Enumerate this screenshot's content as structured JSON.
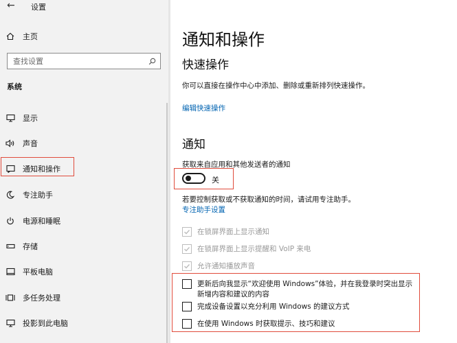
{
  "app": {
    "title": "设置"
  },
  "sidebar": {
    "home_label": "主页",
    "search_placeholder": "查找设置",
    "section_label": "系统",
    "items": [
      {
        "label": "显示",
        "icon": "display-icon"
      },
      {
        "label": "声音",
        "icon": "speaker-icon"
      },
      {
        "label": "通知和操作",
        "icon": "notification-icon",
        "selected": true
      },
      {
        "label": "专注助手",
        "icon": "moon-icon"
      },
      {
        "label": "电源和睡眠",
        "icon": "power-icon"
      },
      {
        "label": "存储",
        "icon": "storage-icon"
      },
      {
        "label": "平板电脑",
        "icon": "tablet-icon"
      },
      {
        "label": "多任务处理",
        "icon": "multitask-icon"
      },
      {
        "label": "投影到此电脑",
        "icon": "project-icon"
      }
    ]
  },
  "main": {
    "title": "通知和操作",
    "quick_actions": {
      "heading": "快速操作",
      "description": "你可以直接在操作中心中添加、删除或重新排列快速操作。",
      "edit_link": "编辑快速操作"
    },
    "notifications": {
      "heading": "通知",
      "get_label": "获取来自应用和其他发送者的通知",
      "toggle_state": "关",
      "focus_hint": "若要控制获取或不获取通知的时间，请试用专注助手。",
      "focus_link": "专注助手设置",
      "disabled_options": [
        "在锁屏界面上显示通知",
        "在锁屏界面上显示提醒和 VoIP 来电",
        "允许通知播放声音"
      ],
      "options": [
        {
          "line1": "更新后向我显示“欢迎使用 Windows”体验，并在我登录时突出显示",
          "line2": "新增内容和建议的内容"
        },
        {
          "line1": "完成设备设置以充分利用 Windows 的建议方式"
        },
        {
          "line1": "在使用 Windows 时获取提示、技巧和建议"
        }
      ]
    }
  },
  "colors": {
    "accent": "#0063b1",
    "highlight": "#e04a3a"
  }
}
